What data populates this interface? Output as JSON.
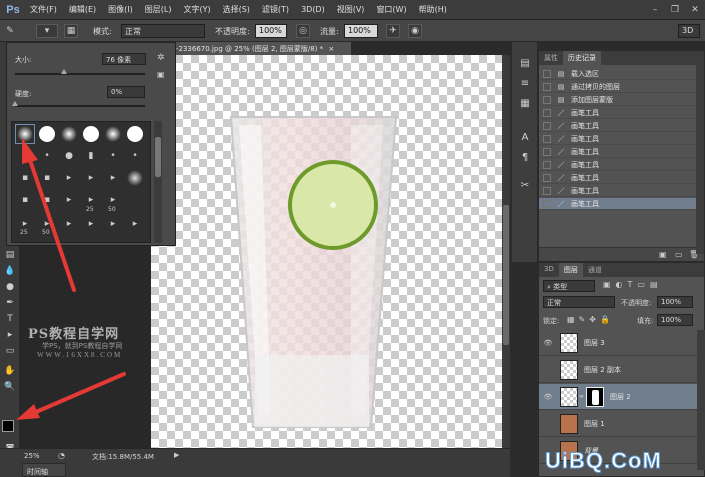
{
  "menu": {
    "logo": "Ps",
    "items": [
      "文件(F)",
      "编辑(E)",
      "图像(I)",
      "图层(L)",
      "文字(Y)",
      "选择(S)",
      "滤镜(T)",
      "3D(D)",
      "视图(V)",
      "窗口(W)",
      "帮助(H)"
    ]
  },
  "options": {
    "mode_label": "模式:",
    "mode_value": "正常",
    "opacity_label": "不透明度:",
    "opacity_value": "100%",
    "flow_label": "流量:",
    "flow_value": "100%",
    "workspace": "3D"
  },
  "document": {
    "tab_title": "-2336670.jpg @ 25% (图层 2, 图层蒙版/8) *",
    "close": "×"
  },
  "brush_popup": {
    "size_label": "大小:",
    "size_value": "76 像素",
    "hardness_label": "硬度:",
    "hardness_value": "0%",
    "numbers": [
      "25",
      "50",
      "25",
      "50"
    ],
    "size_fraction": 0.38,
    "hardness_fraction": 0.0
  },
  "status": {
    "zoom": "25%",
    "doc_info": "文档:15.8M/55.4M",
    "timeline": "时间轴"
  },
  "history": {
    "tabs": [
      "属性",
      "历史记录"
    ],
    "items": [
      {
        "label": "载入选区",
        "icon": "document-icon"
      },
      {
        "label": "通过拷贝的图层",
        "icon": "document-icon"
      },
      {
        "label": "添加图层蒙版",
        "icon": "document-icon"
      },
      {
        "label": "画笔工具",
        "icon": "brush-icon"
      },
      {
        "label": "画笔工具",
        "icon": "brush-icon"
      },
      {
        "label": "画笔工具",
        "icon": "brush-icon"
      },
      {
        "label": "画笔工具",
        "icon": "brush-icon"
      },
      {
        "label": "画笔工具",
        "icon": "brush-icon"
      },
      {
        "label": "画笔工具",
        "icon": "brush-icon"
      },
      {
        "label": "画笔工具",
        "icon": "brush-icon"
      },
      {
        "label": "画笔工具",
        "icon": "brush-icon",
        "selected": true
      }
    ]
  },
  "layers": {
    "tabs": [
      "3D",
      "图层",
      "通道"
    ],
    "filter_label": "类型",
    "blend_mode": "正常",
    "opacity_label": "不透明度:",
    "opacity_value": "100%",
    "lock_label": "锁定:",
    "fill_label": "填充:",
    "fill_value": "100%",
    "items": [
      {
        "name": "图层 3",
        "visible": true,
        "mask": false
      },
      {
        "name": "图层 2 副本",
        "visible": false,
        "mask": false
      },
      {
        "name": "图层 2",
        "visible": true,
        "mask": true,
        "selected": true
      },
      {
        "name": "图层 1",
        "visible": false,
        "mask": false
      },
      {
        "name": "背景",
        "visible": false,
        "mask": false
      }
    ]
  },
  "watermark": {
    "title": "PS教程自学网",
    "subtitle": "学PS，就到PS教程自学网",
    "url": "WWW.16XX8.COM",
    "site_logo": "UiBQ.CoM"
  },
  "colors": {
    "accent_selection": "#6f7d8c",
    "annotation_arrow": "#e53935"
  }
}
